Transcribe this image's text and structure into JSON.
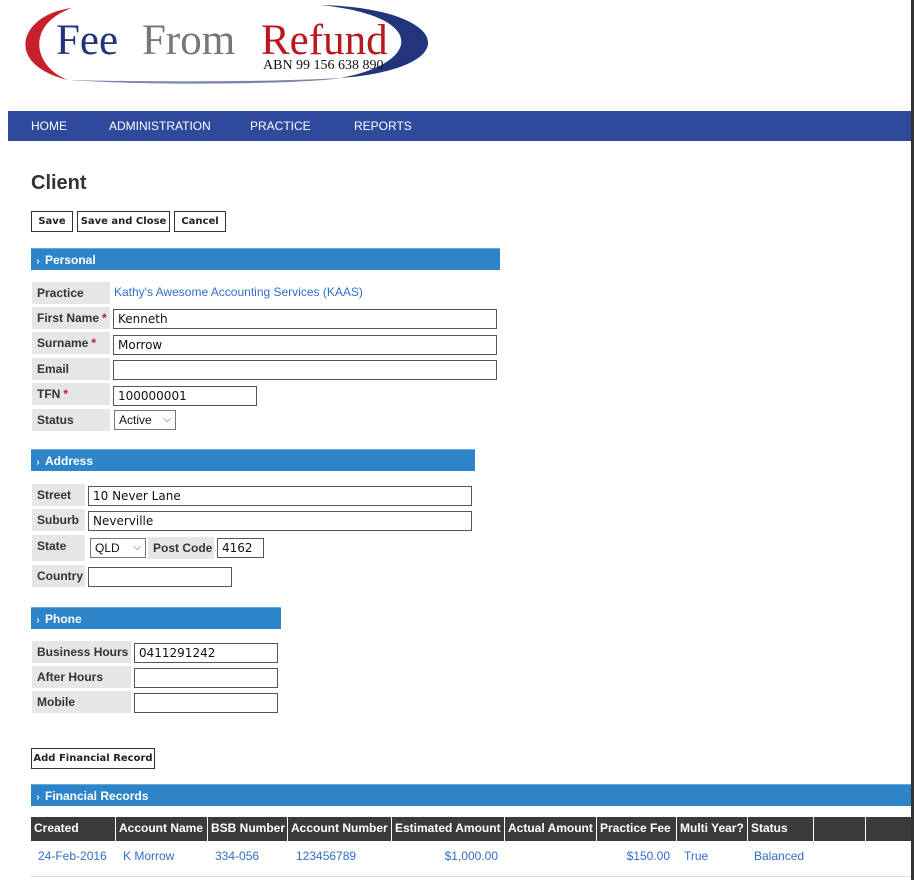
{
  "logo": {
    "word1": "Fee",
    "word2": "From",
    "word3": "Refund",
    "abn": "ABN 99 156 638 890"
  },
  "nav": {
    "items": [
      "HOME",
      "ADMINISTRATION",
      "PRACTICE",
      "REPORTS"
    ]
  },
  "page": {
    "title": "Client"
  },
  "toolbar": {
    "save": "Save",
    "save_close": "Save and Close",
    "cancel": "Cancel"
  },
  "personal": {
    "header": "Personal",
    "practice_label": "Practice",
    "practice_value": "Kathy's Awesome Accounting Services (KAAS)",
    "first_name_label": "First Name",
    "first_name_value": "Kenneth",
    "surname_label": "Surname",
    "surname_value": "Morrow",
    "email_label": "Email",
    "email_value": "",
    "tfn_label": "TFN",
    "tfn_value": "100000001",
    "status_label": "Status",
    "status_value": "Active",
    "required_mark": "*"
  },
  "address": {
    "header": "Address",
    "street_label": "Street",
    "street_value": "10 Never Lane",
    "suburb_label": "Suburb",
    "suburb_value": "Neverville",
    "state_label": "State",
    "state_value": "QLD",
    "postcode_label": "Post Code",
    "postcode_value": "4162",
    "country_label": "Country",
    "country_value": ""
  },
  "phone": {
    "header": "Phone",
    "business_label": "Business Hours",
    "business_value": "0411291242",
    "after_label": "After Hours",
    "after_value": "",
    "mobile_label": "Mobile",
    "mobile_value": ""
  },
  "financial": {
    "add_button": "Add Financial Record",
    "header": "Financial Records",
    "columns": [
      "Created",
      "Account Name",
      "BSB Number",
      "Account Number",
      "Estimated Amount",
      "Actual Amount",
      "Practice Fee",
      "Multi Year?",
      "Status",
      "",
      ""
    ],
    "rows": [
      [
        "24-Feb-2016",
        "K Morrow",
        "334-056",
        "123456789",
        "$1,000.00",
        "",
        "$150.00",
        "True",
        "Balanced"
      ]
    ]
  },
  "colors": {
    "nav": "#2f4a9c",
    "section": "#2e84c8",
    "link": "#2f6fc7",
    "table_header": "#3b3b3b",
    "logo_blue": "#23347c",
    "logo_red": "#b8181e"
  }
}
